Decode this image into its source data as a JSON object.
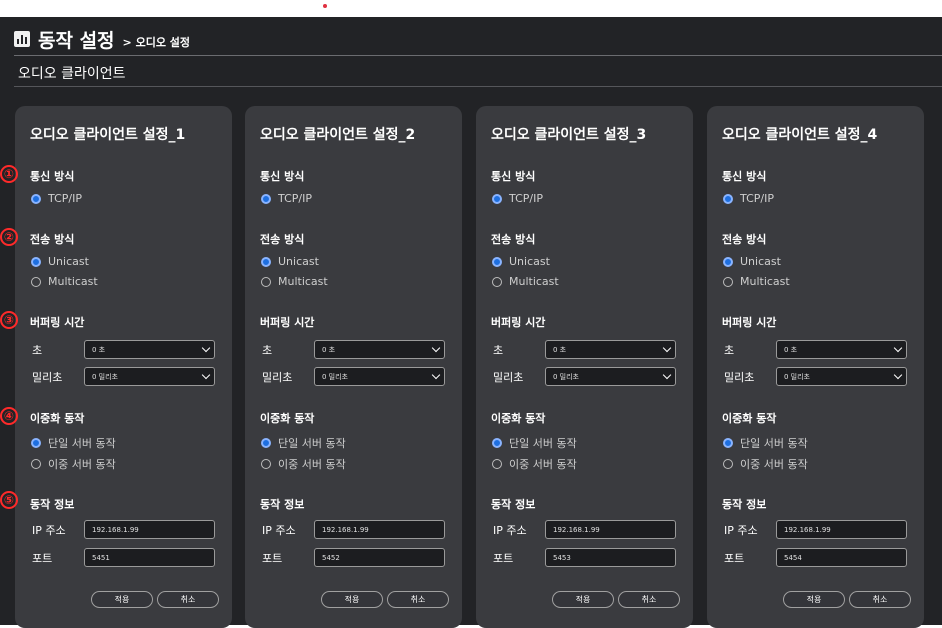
{
  "header": {
    "title": "동작 설정",
    "breadcrumb": "> 오디오 설정",
    "subtab": "오디오 클라이언트"
  },
  "annotations": [
    "①",
    "②",
    "③",
    "④",
    "⑤"
  ],
  "labels": {
    "comm_method": "통신 방식",
    "tcpip": "TCP/IP",
    "trans_method": "전송 방식",
    "unicast": "Unicast",
    "multicast": "Multicast",
    "buffering_time": "버퍼링 시간",
    "sec": "초",
    "msec": "밀리초",
    "redundancy": "이중화 동작",
    "single_server": "단일 서버 동작",
    "dual_server": "이중 서버 동작",
    "op_info": "동작 정보",
    "ip_address": "IP 주소",
    "port": "포트",
    "apply": "적용",
    "cancel": "취소"
  },
  "panels": [
    {
      "title": "오디오 클라이언트 설정_1",
      "sec_value": "0 초",
      "msec_value": "0 밀리초",
      "ip": "192.168.1.99",
      "port": "5451"
    },
    {
      "title": "오디오 클라이언트 설정_2",
      "sec_value": "0 초",
      "msec_value": "0 밀리초",
      "ip": "192.168.1.99",
      "port": "5452"
    },
    {
      "title": "오디오 클라이언트 설정_3",
      "sec_value": "0 초",
      "msec_value": "0 밀리초",
      "ip": "192.168.1.99",
      "port": "5453"
    },
    {
      "title": "오디오 클라이언트 설정_4",
      "sec_value": "0 초",
      "msec_value": "0 밀리초",
      "ip": "192.168.1.99",
      "port": "5454"
    }
  ],
  "colors": {
    "background": "#222326",
    "panel": "#3a3b3f",
    "radio_selected": "#1e6fe0",
    "annotation": "#ff2a2a"
  },
  "icons": {
    "header": "bar-chart-icon",
    "dropdown": "chevron-down-icon"
  }
}
